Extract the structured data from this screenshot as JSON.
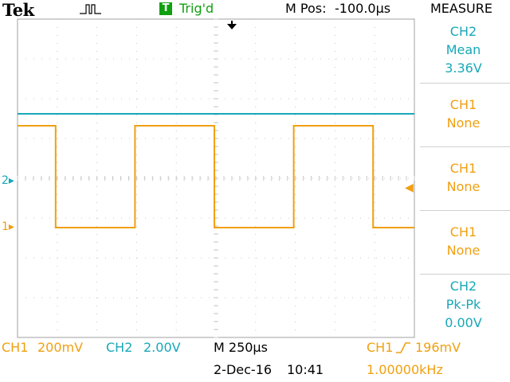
{
  "header": {
    "brand": "Tek",
    "acquisition_icon": "pulse-icon",
    "trigger_badge": "T",
    "trigger_status": "Trig'd",
    "mpos_label": "M Pos:",
    "mpos_value": "-100.0μs",
    "measure_title": "MEASURE"
  },
  "measure": [
    {
      "source": "CH2",
      "type": "Mean",
      "value": "3.36V",
      "color": "#18a8b8"
    },
    {
      "source": "CH1",
      "type": "None",
      "value": "",
      "color": "#f0a010"
    },
    {
      "source": "CH1",
      "type": "None",
      "value": "",
      "color": "#f0a010"
    },
    {
      "source": "CH1",
      "type": "None",
      "value": "",
      "color": "#f0a010"
    },
    {
      "source": "CH2",
      "type": "Pk-Pk",
      "value": "0.00V",
      "color": "#18a8b8"
    }
  ],
  "markers": {
    "ch1": "1",
    "ch2": "2"
  },
  "footer": {
    "ch1_label": "CH1",
    "ch1_scale": "200mV",
    "ch2_label": "CH2",
    "ch2_scale": "2.00V",
    "timebase": "M 250μs",
    "trigger_source": "CH1",
    "trigger_level": "196mV",
    "date": "2-Dec-16",
    "time": "10:41",
    "frequency": "1.00000kHz"
  },
  "colors": {
    "ch1": "#f0a010",
    "ch2": "#18a8b8",
    "trigger": "#10a010",
    "grid": "#c8c8c8"
  },
  "waveform": {
    "ch1_shape": "square",
    "ch1_period_divisions": 4,
    "ch2_shape": "dc"
  }
}
